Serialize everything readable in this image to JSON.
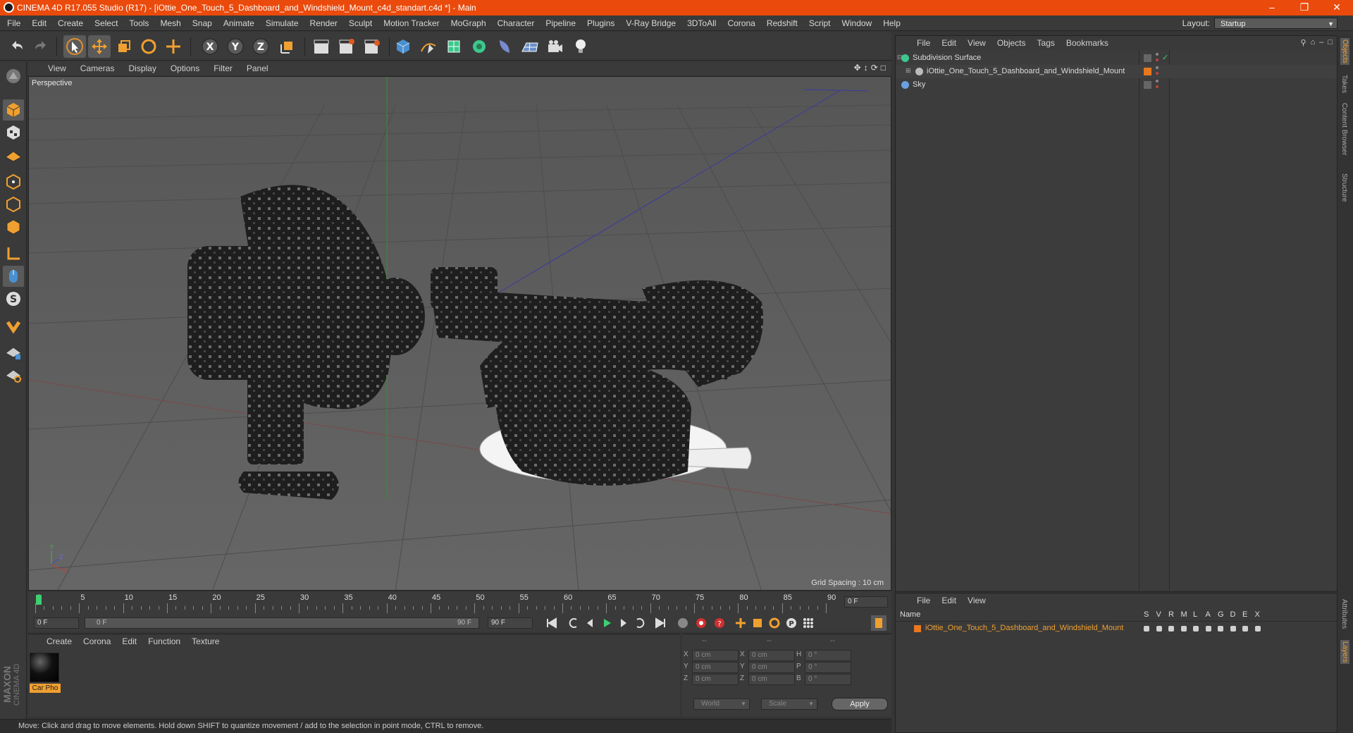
{
  "titlebar": {
    "title": "CINEMA 4D R17.055 Studio (R17) - [iOttie_One_Touch_5_Dashboard_and_Windshield_Mount_c4d_standart.c4d *] - Main"
  },
  "menu": [
    "File",
    "Edit",
    "Create",
    "Select",
    "Tools",
    "Mesh",
    "Snap",
    "Animate",
    "Simulate",
    "Render",
    "Sculpt",
    "Motion Tracker",
    "MoGraph",
    "Character",
    "Pipeline",
    "Plugins",
    "V-Ray Bridge",
    "3DToAll",
    "Corona",
    "Redshift",
    "Script",
    "Window",
    "Help"
  ],
  "layout": {
    "label": "Layout:",
    "value": "Startup"
  },
  "viewport": {
    "menu": [
      "View",
      "Cameras",
      "Display",
      "Options",
      "Filter",
      "Panel"
    ],
    "camera": "Perspective",
    "grid_spacing": "Grid Spacing : 10 cm"
  },
  "timeline": {
    "ticks": [
      "0",
      "5",
      "10",
      "15",
      "20",
      "25",
      "30",
      "35",
      "40",
      "45",
      "50",
      "55",
      "60",
      "65",
      "70",
      "75",
      "80",
      "85",
      "90"
    ],
    "current_frame": "0 F",
    "start_field": "0 F",
    "range_start": "0 F",
    "range_end": "90 F",
    "end_field": "90 F"
  },
  "materials": {
    "menu": [
      "Create",
      "Corona",
      "Edit",
      "Function",
      "Texture"
    ],
    "items": [
      {
        "name": "Car Pho"
      }
    ]
  },
  "coords": {
    "headers": [
      "--",
      "--",
      "--"
    ],
    "rows": [
      {
        "a": "X",
        "av": "0 cm",
        "b": "X",
        "bv": "0 cm",
        "c": "H",
        "cv": "0 °"
      },
      {
        "a": "Y",
        "av": "0 cm",
        "b": "Y",
        "bv": "0 cm",
        "c": "P",
        "cv": "0 °"
      },
      {
        "a": "Z",
        "av": "0 cm",
        "b": "Z",
        "bv": "0 cm",
        "c": "B",
        "cv": "0 °"
      }
    ],
    "mode1": "World",
    "mode2": "Scale",
    "apply": "Apply"
  },
  "objects": {
    "menu": [
      "File",
      "Edit",
      "View",
      "Objects",
      "Tags",
      "Bookmarks"
    ],
    "tree": [
      {
        "name": "Subdivision Surface",
        "color": "#3cc88c"
      },
      {
        "name": "iOttie_One_Touch_5_Dashboard_and_Windshield_Mount",
        "color": "#bbbbbb"
      },
      {
        "name": "Sky",
        "color": "#6aa0e0"
      }
    ]
  },
  "layers": {
    "menu": [
      "File",
      "Edit",
      "View"
    ],
    "header_name": "Name",
    "columns": [
      "S",
      "V",
      "R",
      "M",
      "L",
      "A",
      "G",
      "D",
      "E",
      "X"
    ],
    "items": [
      {
        "name": "iOttie_One_Touch_5_Dashboard_and_Windshield_Mount",
        "color": "#e8781e"
      }
    ]
  },
  "side_tabs": [
    "Objects",
    "Takes",
    "Content Browser",
    "Structure",
    "Attributes",
    "Layers"
  ],
  "status": "Move: Click and drag to move elements. Hold down SHIFT to quantize movement / add to the selection in point mode, CTRL to remove.",
  "brand": {
    "maxon": "MAXON",
    "c4d": "CINEMA 4D"
  },
  "colors": {
    "titlebar": "#ea4a0c",
    "accent": "#f0a030",
    "panel": "#3a3a3a",
    "viewport_bg": "#5d5d5d"
  }
}
